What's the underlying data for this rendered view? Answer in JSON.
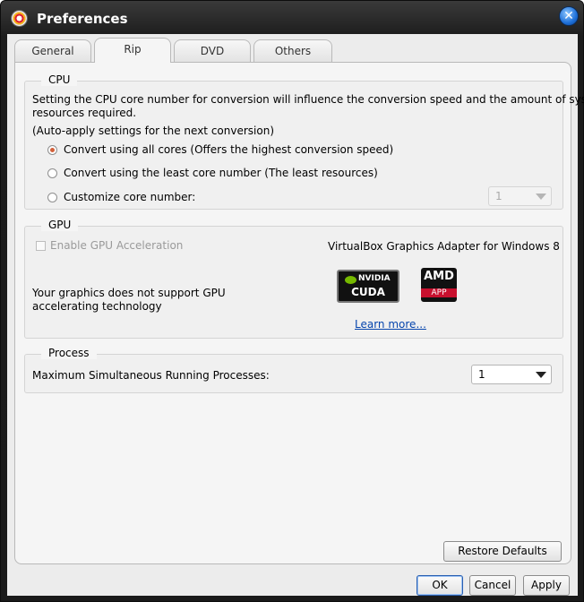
{
  "window": {
    "title": "Preferences",
    "close_glyph": "✕"
  },
  "tabs": [
    {
      "label": "General",
      "active": false
    },
    {
      "label": "Rip",
      "active": true
    },
    {
      "label": "DVD",
      "active": false
    },
    {
      "label": "Others",
      "active": false
    }
  ],
  "cpu": {
    "title": "CPU",
    "description_line1": "Setting the CPU core number for conversion will influence the conversion speed and the amount of system",
    "description_line2": "resources required.",
    "note": "(Auto-apply settings for the next conversion)",
    "options": [
      {
        "label": "Convert using all cores (Offers the highest conversion speed)",
        "selected": true
      },
      {
        "label": "Convert using the least core number (The least resources)",
        "selected": false
      },
      {
        "label": "Customize core number:",
        "selected": false
      }
    ],
    "core_number_value": "1",
    "core_number_enabled": false
  },
  "gpu": {
    "title": "GPU",
    "enable_label": "Enable GPU Acceleration",
    "enable_checked": false,
    "enable_enabled": false,
    "adapter_name": "VirtualBox Graphics Adapter for Windows 8",
    "unsupported_line1": "Your graphics does not support GPU",
    "unsupported_line2": "accelerating technology",
    "cuda_badge": {
      "brand": "NVIDIA",
      "product": "CUDA",
      "icon": "nvidia-cuda-logo"
    },
    "amd_badge": {
      "brand": "AMD",
      "product": "APP",
      "icon": "amd-app-logo"
    },
    "learn_more": "Learn more..."
  },
  "process": {
    "title": "Process",
    "label": "Maximum Simultaneous Running Processes:",
    "value": "1"
  },
  "buttons": {
    "restore_defaults": "Restore Defaults",
    "ok": "OK",
    "cancel": "Cancel",
    "apply": "Apply"
  },
  "colors": {
    "radio_selected": "#d2603a",
    "titlebar": "#1c1c1c",
    "link": "#0645ad"
  }
}
